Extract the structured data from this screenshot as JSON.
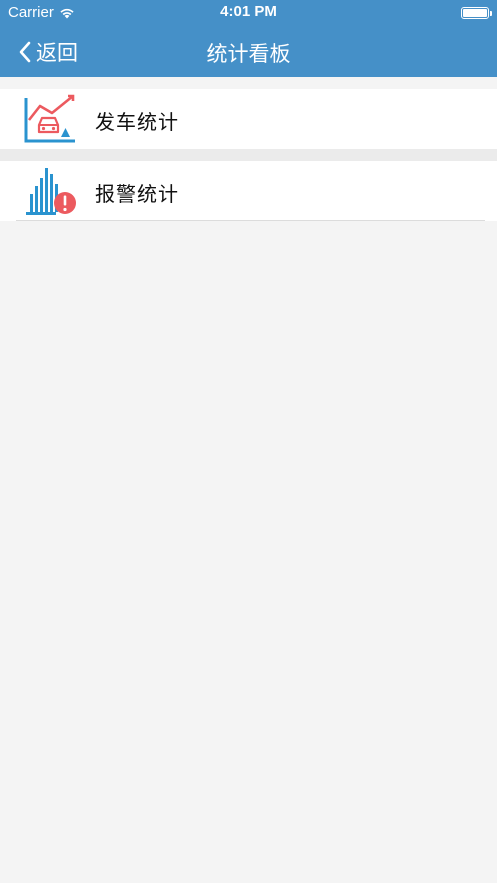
{
  "status_bar": {
    "carrier": "Carrier",
    "time": "4:01 PM",
    "wifi_icon": "wifi-icon",
    "battery_icon": "battery-icon"
  },
  "nav": {
    "back_label": "返回",
    "title": "统计看板",
    "background_color": "#4590c8"
  },
  "menu": {
    "items": [
      {
        "label": "发车统计",
        "icon": "departure-stats-icon"
      },
      {
        "label": "报警统计",
        "icon": "alarm-stats-icon"
      }
    ]
  }
}
